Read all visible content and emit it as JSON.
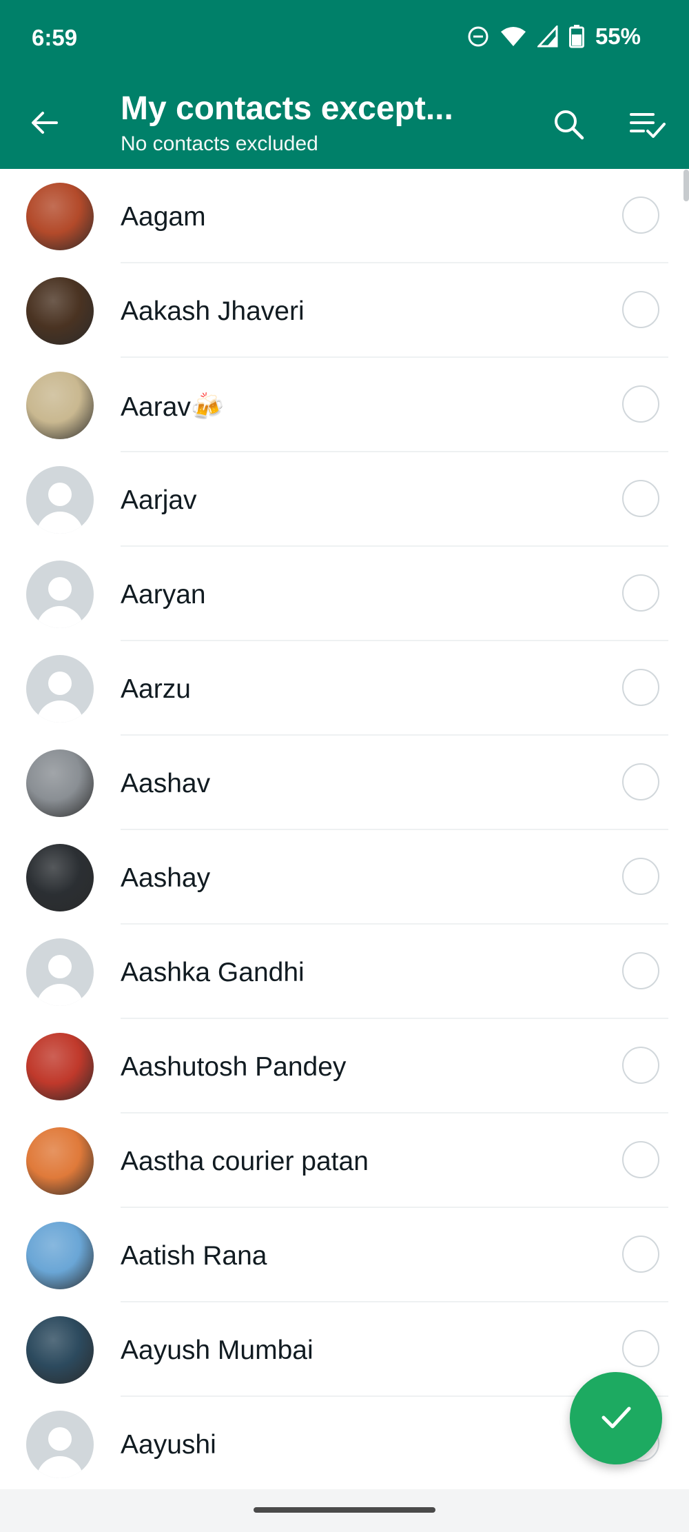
{
  "status_bar": {
    "time": "6:59",
    "battery": "55%",
    "icons": [
      "do-not-disturb-icon",
      "wifi-icon",
      "signal-icon",
      "battery-icon"
    ]
  },
  "app_bar": {
    "title": "My contacts except...",
    "subtitle": "No contacts excluded",
    "icons": [
      "back-arrow-icon",
      "search-icon",
      "select-all-icon"
    ],
    "color": "#008069"
  },
  "contacts": [
    {
      "name": "Aagam",
      "avatar": "photo",
      "avatar_color": "#b34a2a"
    },
    {
      "name": "Aakash Jhaveri",
      "avatar": "photo",
      "avatar_color": "#4a3322"
    },
    {
      "name": "Aarav🍻",
      "avatar": "photo",
      "avatar_color": "#c9b890"
    },
    {
      "name": "Aarjav",
      "avatar": "placeholder"
    },
    {
      "name": "Aaryan",
      "avatar": "placeholder"
    },
    {
      "name": "Aarzu",
      "avatar": "placeholder"
    },
    {
      "name": "Aashav",
      "avatar": "photo",
      "avatar_color": "#8a8f94"
    },
    {
      "name": "Aashay",
      "avatar": "photo",
      "avatar_color": "#2b2f33"
    },
    {
      "name": "Aashka Gandhi",
      "avatar": "placeholder"
    },
    {
      "name": "Aashutosh Pandey",
      "avatar": "photo",
      "avatar_color": "#c0392b"
    },
    {
      "name": "Aastha courier patan",
      "avatar": "photo",
      "avatar_color": "#e07a3a"
    },
    {
      "name": "Aatish Rana",
      "avatar": "photo",
      "avatar_color": "#6aa6d6"
    },
    {
      "name": "Aayush Mumbai",
      "avatar": "photo",
      "avatar_color": "#2c4a5e"
    },
    {
      "name": "Aayushi",
      "avatar": "placeholder"
    }
  ],
  "fab": {
    "icon": "check-icon",
    "color": "#1daa61"
  }
}
